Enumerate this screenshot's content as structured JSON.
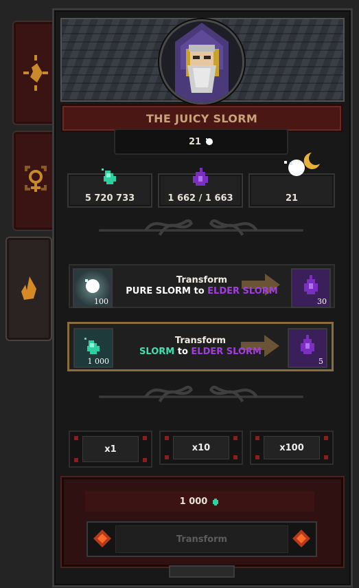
{
  "tabs": [
    {
      "icon": "flame-sparkle-icon",
      "active": false
    },
    {
      "icon": "gender-target-icon",
      "active": false
    },
    {
      "icon": "flame-icon",
      "active": true
    }
  ],
  "npc": {
    "name": "THE JUICY SLORM",
    "portrait_icon": "wizard-portrait-icon"
  },
  "pure_count": {
    "value": "21",
    "icon": "pure-slorm-icon"
  },
  "currencies": [
    {
      "icon": "slorm-icon",
      "value": "5 720 733"
    },
    {
      "icon": "elder-slorm-icon",
      "value": "1 662 / 1 663"
    },
    {
      "icon": "pure-slorm-moon-icon",
      "value": "21"
    }
  ],
  "transforms": [
    {
      "action": "Transform",
      "from_name": "PURE SLORM",
      "to_word": "to",
      "to_name": "ELDER SLORM",
      "from_qty": "100",
      "to_qty": "30",
      "from_icon": "pure-slorm-icon",
      "to_icon": "elder-slorm-icon",
      "selected": false
    },
    {
      "action": "Transform",
      "from_name": "SLORM",
      "to_word": "to",
      "to_name": "ELDER SLORM",
      "from_qty": "1 000",
      "to_qty": "5",
      "from_icon": "slorm-icon",
      "to_icon": "elder-slorm-icon",
      "selected": true
    }
  ],
  "multipliers": [
    "x1",
    "x10",
    "x100"
  ],
  "cost": {
    "value": "1 000",
    "icon": "slorm-icon"
  },
  "transform_button": "Transform",
  "colors": {
    "pure": "#ffffff",
    "slorm": "#3fe0b0",
    "elder": "#a23de0",
    "title": "#c9a27a",
    "selected_border": "#8a6d3b"
  }
}
